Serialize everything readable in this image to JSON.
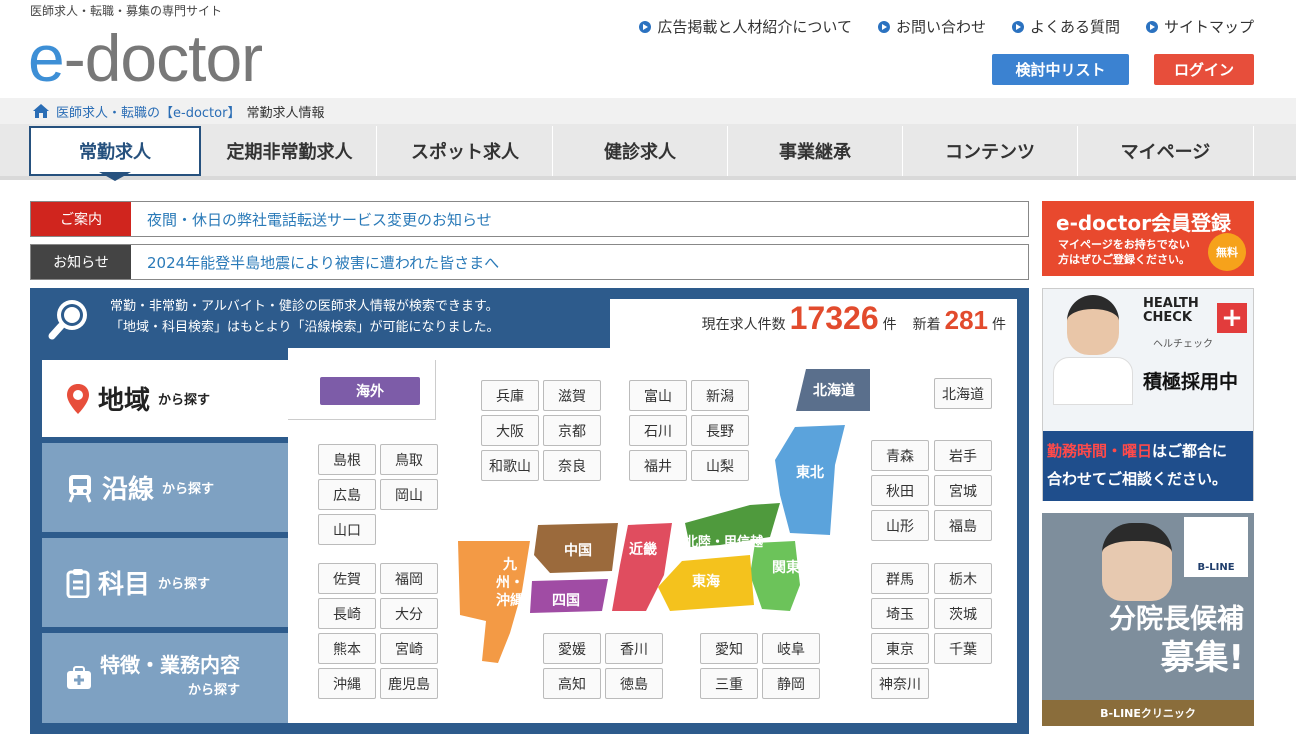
{
  "header": {
    "tagline": "医師求人・転職・募集の専門サイト",
    "logo_e": "e",
    "logo_rest": "-doctor",
    "links": [
      "広告掲載と人材紹介について",
      "お問い合わせ",
      "よくある質問",
      "サイトマップ"
    ],
    "list_button": "検討中リスト",
    "login_button": "ログイン"
  },
  "breadcrumb": {
    "home": "医師求人・転職の【e-doctor】",
    "current": "常勤求人情報"
  },
  "nav": [
    "常勤求人",
    "定期非常勤求人",
    "スポット求人",
    "健診求人",
    "事業継承",
    "コンテンツ",
    "マイページ"
  ],
  "notices": [
    {
      "label": "ご案内",
      "text": "夜間・休日の弊社電話転送サービス変更のお知らせ",
      "color": "#d0251e"
    },
    {
      "label": "お知らせ",
      "text": "2024年能登半島地震により被害に遭われた皆さまへ",
      "color": "#444444"
    }
  ],
  "search": {
    "line1": "常勤・非常勤・アルバイト・健診の医師求人情報が検索できます。",
    "line2": "「地域・科目検索」はもとより「沿線検索」が可能になりました。",
    "count_label": "現在求人件数",
    "count": "17326",
    "count_unit": "件",
    "new_label": "新着",
    "new_count": "281",
    "new_unit": "件",
    "tabs": [
      {
        "label": "地域",
        "sub": "から探す",
        "icon": "pin-icon"
      },
      {
        "label": "沿線",
        "sub": "から探す",
        "icon": "train-icon"
      },
      {
        "label": "科目",
        "sub": "から探す",
        "icon": "clipboard-icon"
      },
      {
        "label": "特徴・業務内容",
        "sub": "から探す",
        "icon": "medical-bag-icon"
      }
    ],
    "overseas": "海外",
    "regions": {
      "hokkaido": "北海道",
      "tohoku": "東北",
      "kanto": "関東",
      "hokuriku": "北陸・甲信越",
      "tokai": "東海",
      "kinki": "近畿",
      "chugoku": "中国",
      "shikoku": "四国",
      "kyushu": "九州・沖縄"
    },
    "prefs": {
      "sanin": [
        "島根",
        "鳥取",
        "広島",
        "岡山",
        "山口"
      ],
      "kyushu": [
        "佐賀",
        "福岡",
        "長崎",
        "大分",
        "熊本",
        "宮崎",
        "沖縄",
        "鹿児島"
      ],
      "kinki": [
        "兵庫",
        "滋賀",
        "大阪",
        "京都",
        "和歌山",
        "奈良"
      ],
      "hokuriku": [
        "富山",
        "新潟",
        "石川",
        "長野",
        "福井",
        "山梨"
      ],
      "shikoku": [
        "愛媛",
        "香川",
        "高知",
        "徳島"
      ],
      "tokai": [
        "愛知",
        "岐阜",
        "三重",
        "静岡"
      ],
      "hokkaido": [
        "北海道"
      ],
      "tohoku": [
        "青森",
        "岩手",
        "秋田",
        "宮城",
        "山形",
        "福島"
      ],
      "kanto": [
        "群馬",
        "栃木",
        "埼玉",
        "茨城",
        "東京",
        "千葉",
        "神奈川"
      ]
    }
  },
  "sidebar": {
    "register_title": "e-doctor会員登録",
    "register_sub1": "マイページをお持ちでない",
    "register_sub2": "方はぜひご登録ください。",
    "register_free": "無料",
    "ad1_brand": "HEALTH CHECK",
    "ad1_sub": "ヘルチェック",
    "ad1_head": "積極採用中",
    "ad1_line1a": "勤務時間・曜日",
    "ad1_line1b": "はご都合に",
    "ad1_line2": "合わせてご相談ください。",
    "ad2_brand": "B-LINE",
    "ad2_line1": "分院長候補",
    "ad2_line2": "募集!",
    "ad2_footer": "B-LINEクリニック"
  }
}
